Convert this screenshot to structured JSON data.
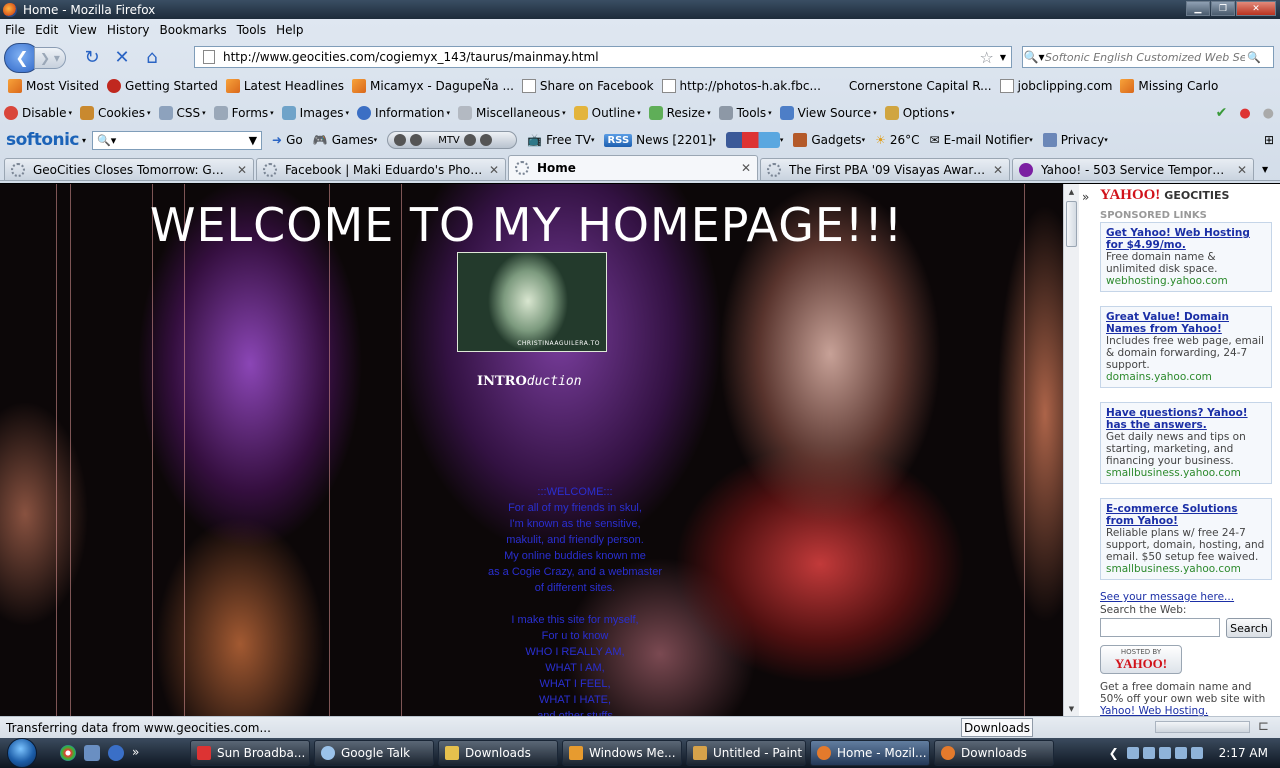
{
  "window": {
    "title": "Home - Mozilla Firefox"
  },
  "menu": [
    "File",
    "Edit",
    "View",
    "History",
    "Bookmarks",
    "Tools",
    "Help"
  ],
  "nav": {
    "url": "http://www.geocities.com/cogiemyx_143/taurus/mainmay.html",
    "search_placeholder": "Softonic English Customized Web Sear"
  },
  "bookmarks": [
    "Most Visited",
    "Getting Started",
    "Latest Headlines",
    "Micamyx - DagupeÑa ...",
    "Share on Facebook",
    "http://photos-h.ak.fbc...",
    "Cornerstone Capital R...",
    "jobclipping.com",
    "Missing Carlo"
  ],
  "devbar": [
    "Disable",
    "Cookies",
    "CSS",
    "Forms",
    "Images",
    "Information",
    "Miscellaneous",
    "Outline",
    "Resize",
    "Tools",
    "View Source",
    "Options"
  ],
  "softonic": {
    "logo": "softonic",
    "go": "Go",
    "games": "Games",
    "mtv": "MTV",
    "freetv": "Free TV",
    "rss": "RSS",
    "news": "News [2201]",
    "gadgets": "Gadgets",
    "temp": "26°C",
    "email": "E-mail Notifier",
    "privacy": "Privacy"
  },
  "tabs": [
    {
      "label": "GeoCities Closes Tomorrow: Goodb..."
    },
    {
      "label": "Facebook | Maki Eduardo's Photos -..."
    },
    {
      "label": "Home"
    },
    {
      "label": "The First PBA '09 Visayas Awards Ni..."
    },
    {
      "label": "Yahoo! - 503 Service Temporarily U..."
    }
  ],
  "page": {
    "heading": "WELCOME TO MY HOMEPAGE!!!",
    "thumb_caption": "CHRISTINAAGUILERA.TO",
    "intro_a": "INTRO",
    "intro_b": "duction",
    "lines": [
      ":::WELCOME:::",
      "For all of my friends in skul,",
      "I'm known as the sensitive,",
      "makulit, and friendly person.",
      "My online buddies known me",
      "as a Cogie Crazy, and a webmaster",
      "of different sites.",
      "",
      "I make this site for myself,",
      "For u to know",
      "WHO I REALLY AM,",
      "WHAT I AM,",
      "WHAT I FEEL,",
      "WHAT I HATE,",
      "and other stuffs"
    ]
  },
  "sidebar": {
    "yahoo": "YAHOO!",
    "geocities": "GEOCITIES",
    "sponsored": "SPONSORED LINKS",
    "ads": [
      {
        "title": "Get Yahoo! Web Hosting for $4.99/mo.",
        "text": "Free domain name & unlimited disk space.",
        "link": "webhosting.yahoo.com"
      },
      {
        "title": "Great Value! Domain Names from Yahoo!",
        "text": "Includes free web page, email & domain forwarding, 24-7 support.",
        "link": "domains.yahoo.com"
      },
      {
        "title": "Have questions? Yahoo! has the answers.",
        "text": "Get daily news and tips on starting, marketing, and financing your business.",
        "link": "smallbusiness.yahoo.com"
      },
      {
        "title": "E-commerce Solutions from Yahoo!",
        "text": "Reliable plans w/ free 24-7 support, domain, hosting, and email. $50 setup fee waived.",
        "link": "smallbusiness.yahoo.com"
      }
    ],
    "see_message": "See your message here...",
    "search_label": "Search the Web:",
    "search_button": "Search",
    "hosted_by": "HOSTED BY",
    "hosted_yahoo": "YAHOO!",
    "get_free": "Get a free domain name and 50% off your own web site with",
    "get_free_link": "Yahoo! Web Hosting."
  },
  "status": {
    "text": "Transferring data from www.geocities.com...",
    "downloads_tip": "Downloads"
  },
  "taskbar": {
    "items": [
      "Sun Broadba...",
      "Google Talk",
      "Downloads",
      "Windows Me...",
      "Untitled - Paint",
      "Home - Mozil...",
      "Downloads"
    ],
    "time": "2:17 AM"
  },
  "colors": {
    "link_blue": "#1b2fa6",
    "yahoo_red": "#d1121a",
    "page_text": "#2a2fd0"
  }
}
